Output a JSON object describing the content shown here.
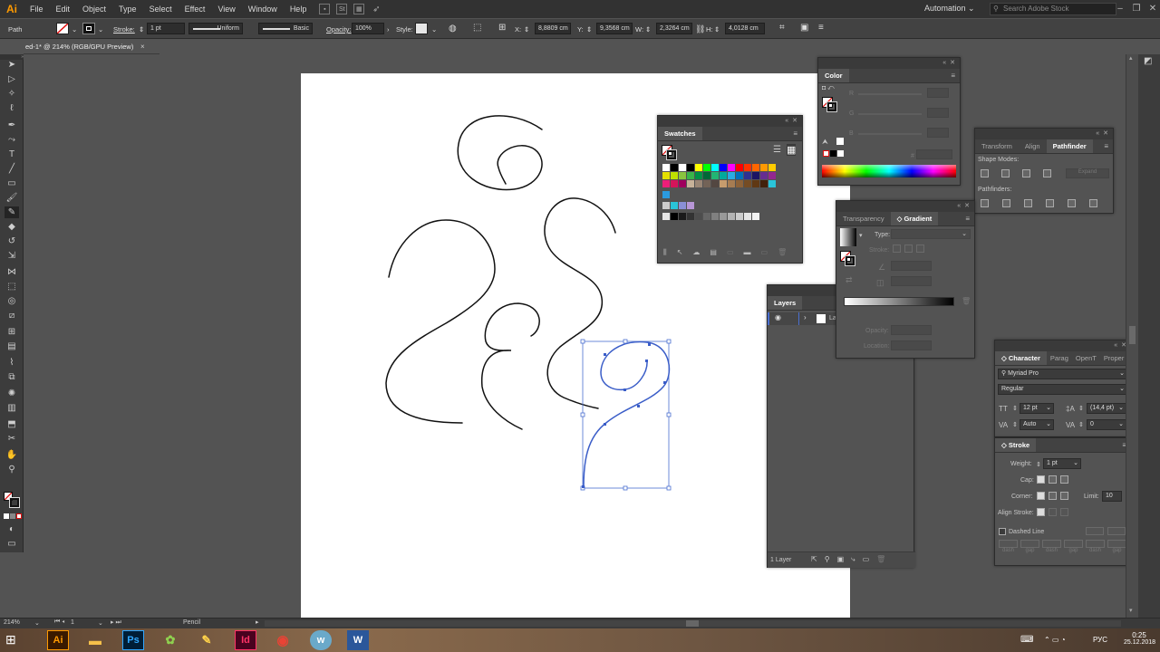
{
  "app": {
    "logo": "Ai",
    "menus": [
      "File",
      "Edit",
      "Object",
      "Type",
      "Select",
      "Effect",
      "View",
      "Window",
      "Help"
    ],
    "workspace": "Automation",
    "search_placeholder": "Search Adobe Stock"
  },
  "control_bar": {
    "object_type": "Path",
    "stroke_label": "Stroke:",
    "stroke_weight": "1 pt",
    "profile": "Uniform",
    "brush": "Basic",
    "opacity_label": "Opacity:",
    "opacity": "100%",
    "style_label": "Style:",
    "x_label": "X:",
    "x": "8,8809 cm",
    "y_label": "Y:",
    "y": "9,3568 cm",
    "w_label": "W:",
    "w": "2,3264 cm",
    "h_label": "H:",
    "h": "4,0128 cm"
  },
  "document": {
    "tab_title": "ed-1* @ 214% (RGB/GPU Preview)",
    "close": "×"
  },
  "toolbar": {
    "icons": [
      "selection-tool-icon",
      "direct-selection-tool-icon",
      "magic-wand-tool-icon",
      "lasso-tool-icon",
      "pen-tool-icon",
      "curvature-tool-icon",
      "type-tool-icon",
      "line-tool-icon",
      "rectangle-tool-icon",
      "paintbrush-tool-icon",
      "pencil-tool-icon",
      "eraser-tool-icon",
      "rotate-tool-icon",
      "scale-tool-icon",
      "width-tool-icon",
      "free-transform-tool-icon",
      "shape-builder-tool-icon",
      "perspective-tool-icon",
      "mesh-tool-icon",
      "gradient-tool-icon",
      "eyedropper-tool-icon",
      "blend-tool-icon",
      "symbol-sprayer-tool-icon",
      "column-graph-tool-icon",
      "artboard-tool-icon",
      "slice-tool-icon",
      "hand-tool-icon",
      "zoom-tool-icon"
    ]
  },
  "panels": {
    "swatches": {
      "title": "Swatches"
    },
    "color": {
      "title": "Color",
      "r": "R",
      "g": "G",
      "b": "B",
      "hash": "#"
    },
    "transform_group": {
      "tabs": [
        "Transform",
        "Align",
        "Pathfinder"
      ],
      "shape_modes": "Shape Modes:",
      "pathfinders": "Pathfinders:",
      "expand": "Expand"
    },
    "gradient_group": {
      "tabs": [
        "Transparency",
        "Gradient"
      ],
      "type_label": "Type:",
      "stroke_label": "Stroke:",
      "opacity_label": "Opacity:",
      "location_label": "Location:"
    },
    "layers": {
      "title": "Layers",
      "layer_name": "La",
      "footer": "1 Layer"
    },
    "character": {
      "tabs": [
        "Character",
        "Parag",
        "OpenT",
        "Proper"
      ],
      "font": "Myriad Pro",
      "style": "Regular",
      "size": "12 pt",
      "leading": "(14,4 pt)",
      "kerning": "Auto",
      "tracking": "0"
    },
    "stroke": {
      "title": "Stroke",
      "weight_label": "Weight:",
      "weight": "1 pt",
      "cap_label": "Cap:",
      "corner_label": "Corner:",
      "limit_label": "Limit:",
      "limit": "10",
      "limit_unit": "x",
      "align_label": "Align Stroke:",
      "dashed": "Dashed Line",
      "dash_labels": [
        "dash",
        "gap",
        "dash",
        "gap",
        "dash",
        "gap"
      ]
    }
  },
  "status": {
    "zoom": "214%",
    "artboard_num": "1",
    "tool": "Pencil"
  },
  "taskbar": {
    "apps": [
      {
        "name": "Ai",
        "color": "#ff9a00"
      },
      {
        "name": "Ps",
        "color": "#31a8ff"
      },
      {
        "name": "Id",
        "color": "#ff3366"
      },
      {
        "name": "W",
        "color": "#2b579a"
      }
    ],
    "lang": "РУС",
    "time": "0:25",
    "date": "25.12.2018"
  }
}
